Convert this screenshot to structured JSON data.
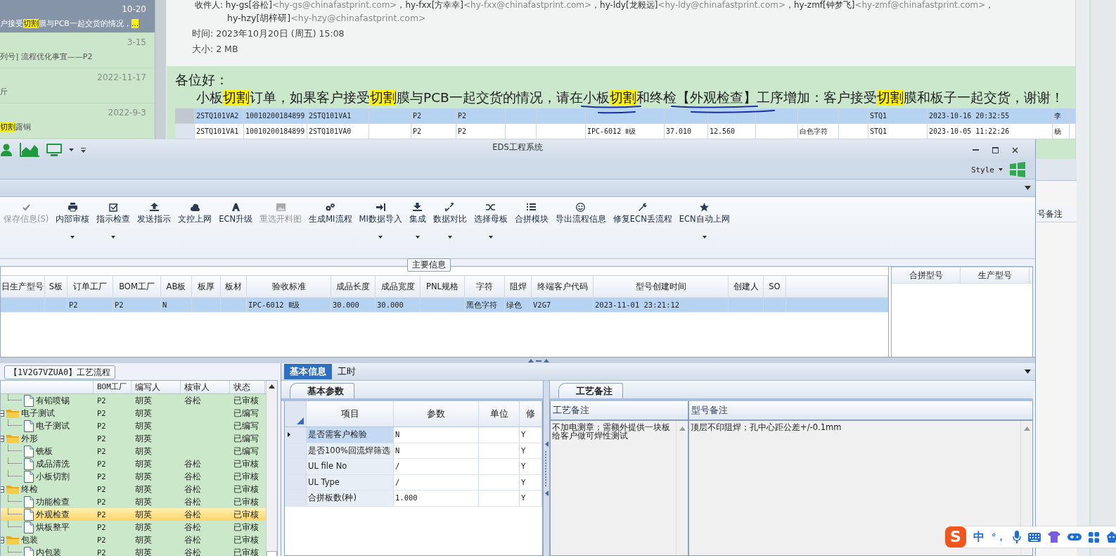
{
  "mail_list": {
    "items": [
      {
        "date": "10-20",
        "selected": true,
        "preview": [
          {
            "text": "户接受",
            "highlight": false
          },
          {
            "text": "切割",
            "highlight": true
          },
          {
            "text": "膜与PCB一起交货的情况，",
            "highlight": false
          },
          {
            "text": "...",
            "highlight": true
          }
        ]
      },
      {
        "date": "3-15",
        "selected": false,
        "preview": [
          {
            "text": "列号] 流程优化事宜——P2",
            "highlight": false
          }
        ]
      },
      {
        "date": "2022-11-17",
        "selected": false,
        "preview": [
          {
            "text": "斤",
            "highlight": false
          }
        ]
      },
      {
        "date": "2022-9-3",
        "selected": false,
        "preview": [
          {
            "text": "切割",
            "highlight": true
          },
          {
            "text": "露铜",
            "highlight": false
          }
        ]
      }
    ]
  },
  "mail_header": {
    "lines": [
      [
        {
          "text": "收件人: hy-gs[谷松]",
          "muted": false
        },
        {
          "text": "<hy-gs@chinafastprint.com>",
          "muted": true
        },
        {
          "text": "，hy-fxx[方幸幸]",
          "muted": false
        },
        {
          "text": "<hy-fxx@chinafastprint.com>",
          "muted": true
        },
        {
          "text": "，hy-ldy[龙毅远]",
          "muted": false
        },
        {
          "text": "<hy-ldy@chinafastprint.com>",
          "muted": true
        },
        {
          "text": "，hy-zmf[钟梦飞]",
          "muted": false
        },
        {
          "text": "<hy-zmf@chinafastprint.com>",
          "muted": true
        },
        {
          "text": "，",
          "muted": false
        }
      ],
      [
        {
          "text": "hy-hzy[胡梓研]",
          "muted": false
        },
        {
          "text": "<hy-hzy@chinafastprint.com>",
          "muted": true
        }
      ]
    ],
    "time": "时间: 2023年10月20日 (周五) 15:08",
    "size": "大小: 2 MB"
  },
  "mail_body": {
    "greeting": "各位好：",
    "paragraph": [
      {
        "text": "小板",
        "highlight": false
      },
      {
        "text": "切割",
        "highlight": true
      },
      {
        "text": "订单，如果客户接受",
        "highlight": false
      },
      {
        "text": "切割",
        "highlight": true
      },
      {
        "text": "膜与PCB一起交货的情况，请在小板",
        "highlight": false
      },
      {
        "text": "切割",
        "highlight": true
      },
      {
        "text": "和终检【外观检查】工序增加：客户接受",
        "highlight": false
      },
      {
        "text": "切割",
        "highlight": true
      },
      {
        "text": "膜和板子一起交货，谢谢！",
        "highlight": false
      }
    ],
    "table": {
      "rows": [
        {
          "selected": true,
          "cells": [
            "2STQ101VA2",
            "10010200184899",
            "2STQ101VA1",
            null,
            "P2",
            "P2",
            null,
            null,
            null,
            null,
            null,
            null,
            null,
            null,
            "STQ1",
            "2023-10-16 20:32:55",
            "李"
          ]
        },
        {
          "selected": false,
          "cells": [
            "2STQ101VA1",
            "10010200184899",
            "2STQ101VA0",
            null,
            "P2",
            "P2",
            null,
            null,
            "IPC-6012 Ⅱ级",
            "37.010",
            "12.560",
            null,
            "白色字符",
            null,
            "STQ1",
            "2023-10-05 11:22:26",
            "杨"
          ]
        }
      ]
    }
  },
  "background_window": {
    "column": "号备注"
  },
  "eds_window": {
    "title": "EDS工程系统",
    "style_menu": "Style",
    "ribbon": [
      {
        "label": "保存信息(S)",
        "disabled": true,
        "dropdown": false
      },
      {
        "label": "内部审核",
        "disabled": false,
        "dropdown": true
      },
      {
        "label": "指示检查",
        "disabled": false,
        "dropdown": true
      },
      {
        "label": "发送指示",
        "disabled": false,
        "dropdown": false
      },
      {
        "label": "文控上网",
        "disabled": false,
        "dropdown": false
      },
      {
        "label": "ECN升级",
        "disabled": false,
        "dropdown": false
      },
      {
        "label": "重选开料图",
        "disabled": true,
        "dropdown": false
      },
      {
        "label": "生成MI流程",
        "disabled": false,
        "dropdown": false
      },
      {
        "label": "MI数据导入",
        "disabled": false,
        "dropdown": true
      },
      {
        "label": "集成",
        "disabled": false,
        "dropdown": true
      },
      {
        "label": "数据对比",
        "disabled": false,
        "dropdown": true
      },
      {
        "label": "选择母板",
        "disabled": false,
        "dropdown": true
      },
      {
        "label": "合拼模块",
        "disabled": false,
        "dropdown": false
      },
      {
        "label": "导出流程信息",
        "disabled": false,
        "dropdown": false
      },
      {
        "label": "修复ECN丢流程",
        "disabled": false,
        "dropdown": false
      },
      {
        "label": "ECN自动上网",
        "disabled": false,
        "dropdown": true
      }
    ],
    "main_info": {
      "caption": "主要信息",
      "columns": [
        "日生产型号",
        "S板",
        "订单工厂",
        "BOM工厂",
        "AB板",
        "板厚",
        "板材",
        "验收标准",
        "成品长度",
        "成品宽度",
        "PNL规格",
        "字符",
        "阻焊",
        "终端客户代码",
        "型号创建时间",
        "创建人",
        "SO"
      ],
      "rows": [
        {
          "selected": true,
          "cells": [
            null,
            null,
            "P2",
            "P2",
            "N",
            null,
            null,
            "IPC-6012 Ⅱ级",
            "30.000",
            "30.000",
            null,
            "黑色字符",
            "绿色",
            "V2G7",
            "2023-11-01 23:21:12",
            null,
            null
          ]
        }
      ],
      "side_columns": [
        "合拼型号",
        "生产型号"
      ]
    },
    "process": {
      "caption": "【1V2G7VZUA0】工艺流程",
      "columns": [
        "BOM工厂",
        "编写人",
        "核审人",
        "状态"
      ],
      "tree": [
        {
          "kind": "file",
          "name": "有铅喷锡",
          "bom": "P2",
          "writer": "胡英",
          "reviewer": "谷松",
          "status": "已审核",
          "selected": false
        },
        {
          "kind": "folder",
          "name": "电子测试",
          "bom": "P2",
          "writer": "胡英",
          "status": "已编写",
          "selected": false,
          "expanded": true,
          "children": [
            {
              "kind": "file",
              "name": "电子测试",
              "bom": "P2",
              "writer": "胡英",
              "status": "已编写",
              "selected": false
            }
          ]
        },
        {
          "kind": "folder",
          "name": "外形",
          "bom": "P2",
          "writer": "胡英",
          "status": "已编写",
          "selected": false,
          "expanded": true,
          "children": [
            {
              "kind": "file",
              "name": "铣板",
              "bom": "P2",
              "writer": "胡英",
              "status": "已编写",
              "selected": false
            },
            {
              "kind": "file",
              "name": "成品清洗",
              "bom": "P2",
              "writer": "胡英",
              "reviewer": "谷松",
              "status": "已审核",
              "selected": false
            },
            {
              "kind": "file",
              "name": "小板切割",
              "bom": "P2",
              "writer": "胡英",
              "reviewer": "谷松",
              "status": "已审核",
              "selected": false
            }
          ]
        },
        {
          "kind": "folder",
          "name": "终检",
          "bom": "P2",
          "writer": "胡英",
          "reviewer": "谷松",
          "status": "已审核",
          "selected": false,
          "expanded": true,
          "children": [
            {
              "kind": "file",
              "name": "功能检查",
              "bom": "P2",
              "writer": "胡英",
              "reviewer": "谷松",
              "status": "已审核",
              "selected": false
            },
            {
              "kind": "file",
              "name": "外观检查",
              "bom": "P2",
              "writer": "胡英",
              "reviewer": "谷松",
              "status": "已审核",
              "selected": true
            },
            {
              "kind": "file",
              "name": "烘板整平",
              "bom": "P2",
              "writer": "胡英",
              "reviewer": "谷松",
              "status": "已审核",
              "selected": false
            }
          ]
        },
        {
          "kind": "folder",
          "name": "包装",
          "bom": "P2",
          "writer": "胡英",
          "reviewer": "谷松",
          "status": "已审核",
          "selected": false,
          "expanded": true,
          "children": [
            {
              "kind": "file",
              "name": "内包装",
              "bom": "P2",
              "writer": "胡英",
              "reviewer": "谷松",
              "status": "已审核",
              "selected": false
            }
          ]
        }
      ]
    },
    "detail_tabs": [
      {
        "label": "基本信息",
        "selected": true
      },
      {
        "label": "工时",
        "selected": false
      }
    ],
    "params": {
      "tab": "基本参数",
      "columns": [
        "项目",
        "参数",
        "单位",
        "修"
      ],
      "rows": [
        {
          "item": "是否需客户检验",
          "value": "N",
          "flag": "Y",
          "current": true
        },
        {
          "item": "是否100%回流焊筛选",
          "value": "N",
          "flag": "Y",
          "current": false
        },
        {
          "item": "UL file No",
          "value": "/",
          "flag": "Y",
          "current": false
        },
        {
          "item": "UL Type",
          "value": "/",
          "flag": "Y",
          "current": false
        },
        {
          "item": "合拼板数(种)",
          "value": "1.000",
          "flag": "Y",
          "current": false
        }
      ]
    },
    "notes": {
      "tab": "工艺备注",
      "columns": [
        "工艺备注",
        "型号备注"
      ],
      "process_note": "不加电测章；需额外提供一块板给客户做可焊性测试",
      "model_note": "顶层不印阻焊；孔中心距公差+/-0.1mm"
    }
  },
  "ime_bar": {
    "logo": "S",
    "mode": "中",
    "punctuation": "°，"
  }
}
